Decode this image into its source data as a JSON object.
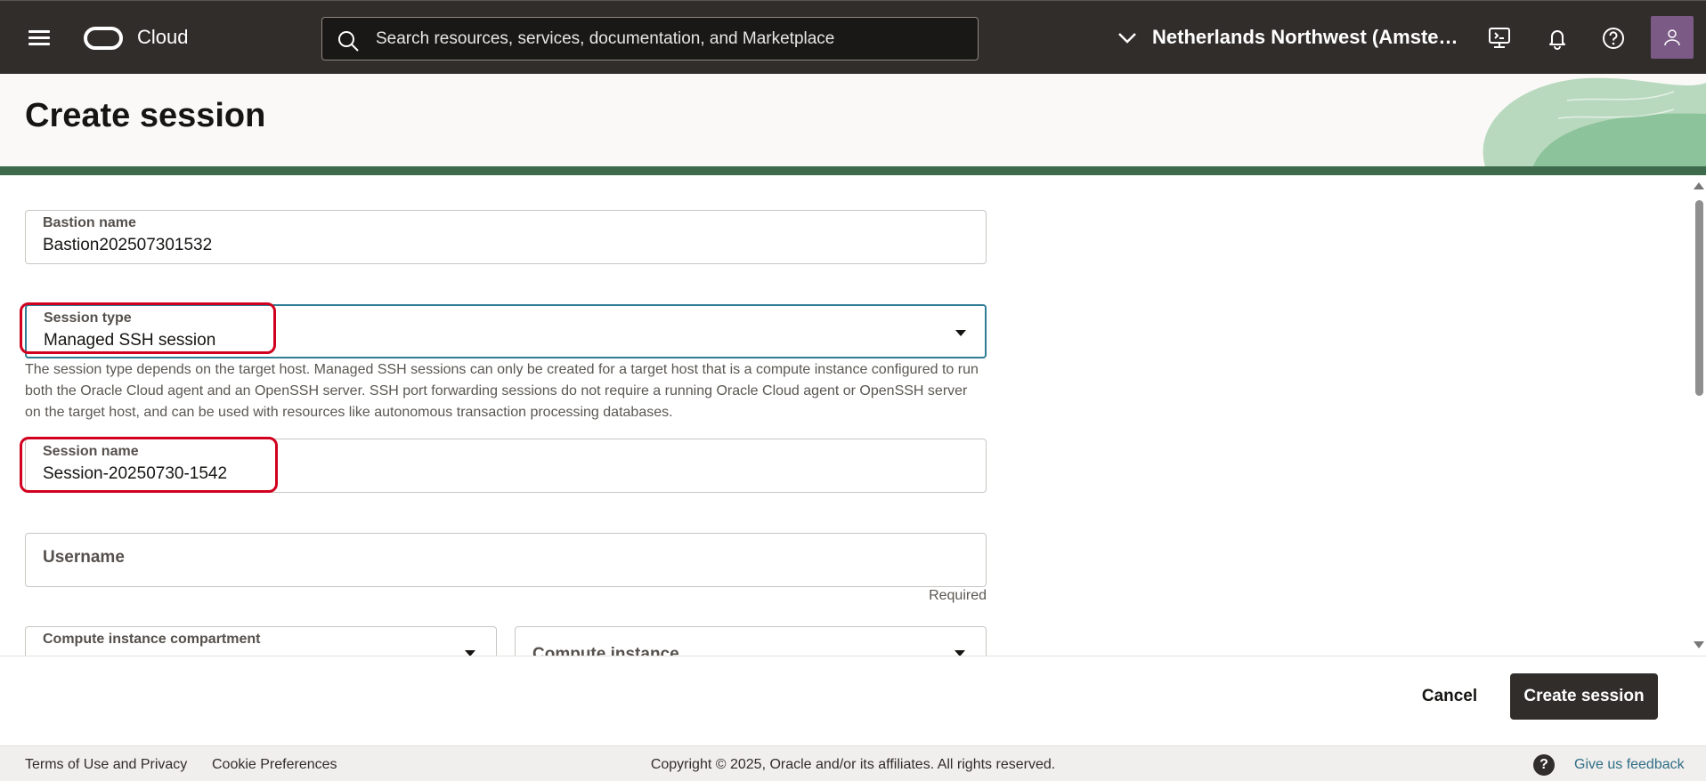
{
  "topbar": {
    "brand": "Cloud",
    "search_placeholder": "Search resources, services, documentation, and Marketplace",
    "region": "Netherlands Northwest (Amste…"
  },
  "page": {
    "title": "Create session"
  },
  "form": {
    "bastion_name": {
      "label": "Bastion name",
      "value": "Bastion202507301532"
    },
    "session_type": {
      "label": "Session type",
      "value": "Managed SSH session",
      "help": "The session type depends on the target host. Managed SSH sessions can only be created for a target host that is a compute instance configured to run both the Oracle Cloud agent and an OpenSSH server. SSH port forwarding sessions do not require a running Oracle Cloud agent or OpenSSH server on the target host, and can be used with resources like autonomous transaction processing databases."
    },
    "session_name": {
      "label": "Session name",
      "value": "Session-20250730-1542"
    },
    "username": {
      "placeholder": "Username",
      "required": "Required"
    },
    "compute_compartment": {
      "label": "Compute instance compartment"
    },
    "compute_instance": {
      "placeholder": "Compute instance"
    }
  },
  "actions": {
    "cancel": "Cancel",
    "create": "Create session"
  },
  "footer": {
    "terms": "Terms of Use and Privacy",
    "cookies": "Cookie Preferences",
    "copyright": "Copyright © 2025, Oracle and/or its affiliates. All rights reserved.",
    "feedback": "Give us feedback",
    "help_glyph": "?"
  },
  "colors": {
    "topbar_bg": "#312d2a",
    "focus_border": "#2f7c95",
    "highlight_red": "#d1001f",
    "primary_button": "#312d2a",
    "feedback_link": "#2f6e86"
  }
}
